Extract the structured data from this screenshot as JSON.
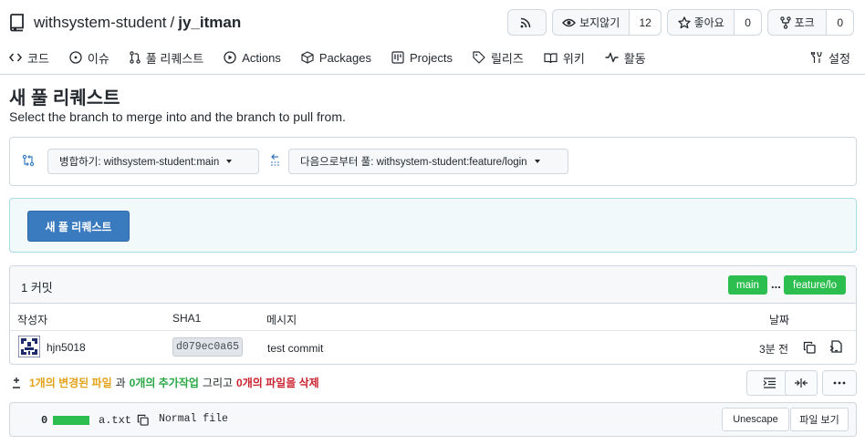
{
  "repo": {
    "owner": "withsystem-student",
    "separator": "/",
    "name": "jy_itman"
  },
  "header_buttons": {
    "rss": {
      "icon": "rss-icon"
    },
    "watch": {
      "label": "보지않기",
      "count": "12",
      "icon": "eye-icon"
    },
    "star": {
      "label": "좋아요",
      "count": "0",
      "icon": "star-icon"
    },
    "fork": {
      "label": "포크",
      "count": "0",
      "icon": "fork-icon"
    }
  },
  "tabs": [
    {
      "label": "코드",
      "icon": "code-icon"
    },
    {
      "label": "이슈",
      "icon": "issue-icon"
    },
    {
      "label": "풀 리퀘스트",
      "icon": "pull-request-icon"
    },
    {
      "label": "Actions",
      "icon": "play-icon"
    },
    {
      "label": "Packages",
      "icon": "package-icon"
    },
    {
      "label": "Projects",
      "icon": "project-icon"
    },
    {
      "label": "릴리즈",
      "icon": "tag-icon"
    },
    {
      "label": "위키",
      "icon": "book-icon"
    },
    {
      "label": "활동",
      "icon": "pulse-icon"
    }
  ],
  "settings": {
    "label": "설정",
    "icon": "tools-icon"
  },
  "page": {
    "title": "새 풀 리퀘스트",
    "subtitle": "Select the branch to merge into and the branch to pull from."
  },
  "branches": {
    "base_label": "병합하기: withsystem-student:main",
    "head_label": "다음으로부터 풀: withsystem-student:feature/login"
  },
  "create_button": "새 풀 리퀘스트",
  "commits": {
    "count_label": "1 커밋",
    "base_branch": "main",
    "ellipsis": "...",
    "head_branch": "feature/lo",
    "columns": {
      "author": "작성자",
      "sha": "SHA1",
      "message": "메시지",
      "date": "날짜"
    },
    "rows": [
      {
        "author": "hjn5018",
        "sha": "d079ec0a65",
        "message": "test commit",
        "date": "3분 전"
      }
    ]
  },
  "summary": {
    "icon": "plus-minus-icon",
    "changed": "1개의 변경된 파일",
    "and1": "과",
    "added": "0개의 추가작업",
    "and2": "그리고",
    "deleted": "0개의 파일을 삭제"
  },
  "files": [
    {
      "num": "0",
      "name": "a.txt",
      "status": "Normal file",
      "unescape": "Unescape",
      "view": "파일 보기"
    }
  ],
  "colors": {
    "accent": "#3a7bbf",
    "green": "#2cbe4e",
    "orange": "#e3a21a",
    "red": "#cb2431",
    "border": "#d0d7de"
  }
}
